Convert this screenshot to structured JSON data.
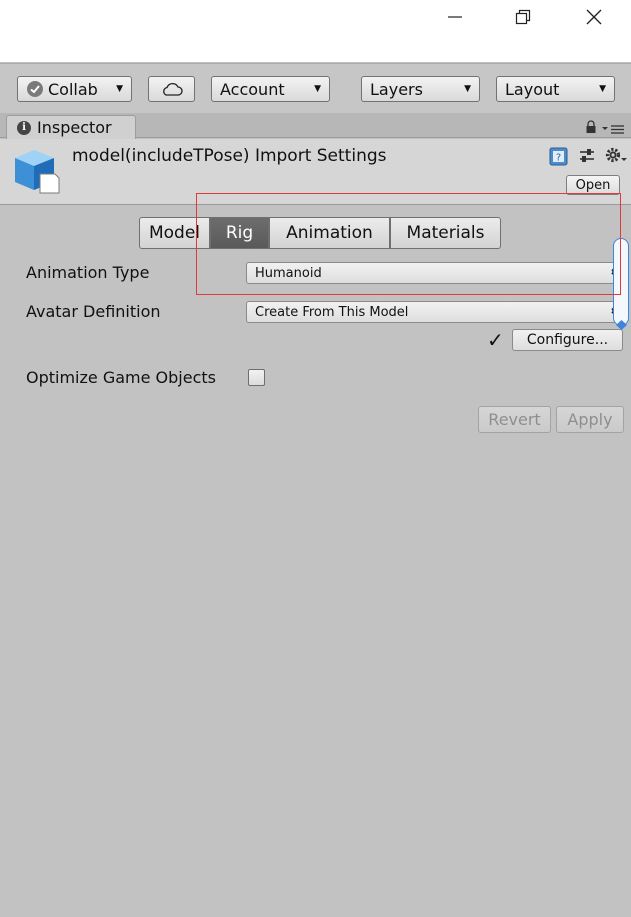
{
  "window": {
    "minimize_glyph": "—",
    "restore_glyph": "❐",
    "close_glyph": "✕"
  },
  "toolbar": {
    "collab_label": "Collab",
    "account_label": "Account",
    "layers_label": "Layers",
    "layout_label": "Layout",
    "arrow": "▼"
  },
  "tab": {
    "inspector_label": "Inspector",
    "info_glyph": "i"
  },
  "header": {
    "title": "model(includeTPose) Import Settings",
    "open_label": "Open"
  },
  "segments": {
    "model": "Model",
    "rig": "Rig",
    "animation": "Animation",
    "materials": "Materials",
    "active": "Rig"
  },
  "fields": {
    "animation_type_label": "Animation Type",
    "animation_type_value": "Humanoid",
    "avatar_definition_label": "Avatar Definition",
    "avatar_definition_value": "Create From This Model",
    "configure_status": "✓",
    "configure_label": "Configure...",
    "optimize_label": "Optimize Game Objects",
    "optimize_checked": false
  },
  "actions": {
    "revert_label": "Revert",
    "apply_label": "Apply"
  },
  "colors": {
    "panel_bg": "#c2c2c2",
    "active_segment": "#5f5f5f",
    "highlight_border": "#e03b3b",
    "scroll_accent": "#3d86d9"
  }
}
